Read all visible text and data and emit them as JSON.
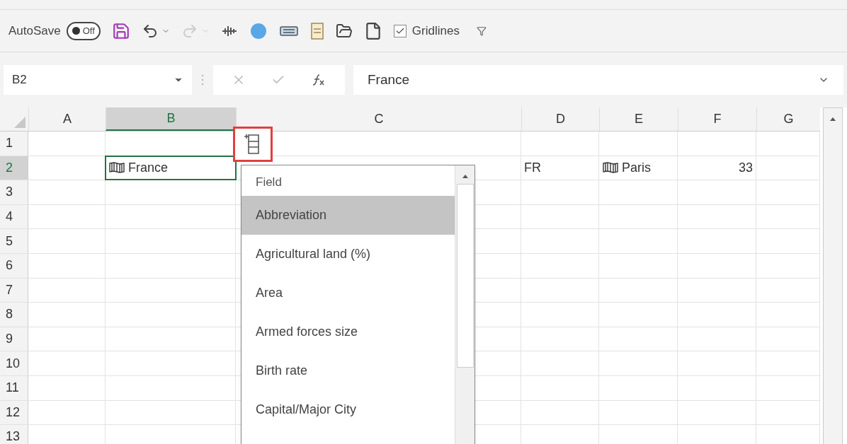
{
  "toolbar": {
    "autosave": {
      "label": "AutoSave",
      "on": false,
      "state_label": "Off"
    },
    "gridlines": {
      "label": "Gridlines",
      "checked": true
    }
  },
  "formula_bar": {
    "name_box": "B2",
    "value": "France"
  },
  "columns": [
    {
      "label": "A",
      "selected": false
    },
    {
      "label": "B",
      "selected": true
    },
    {
      "label": "C",
      "selected": false
    },
    {
      "label": "D",
      "selected": false
    },
    {
      "label": "E",
      "selected": false
    },
    {
      "label": "F",
      "selected": false
    },
    {
      "label": "G",
      "selected": false
    }
  ],
  "rows": [
    {
      "number": "1",
      "selected": false
    },
    {
      "number": "2",
      "selected": true,
      "cells": [
        {},
        {
          "text": "France",
          "kind": "linked",
          "selected": true
        },
        {},
        {
          "text": "FR",
          "kind": "text",
          "selected": false
        },
        {
          "text": "Paris",
          "kind": "linked",
          "selected": false
        },
        {
          "text": "33",
          "kind": "number",
          "selected": false
        },
        {}
      ]
    },
    {
      "number": "3",
      "selected": false
    },
    {
      "number": "4",
      "selected": false
    },
    {
      "number": "5",
      "selected": false
    },
    {
      "number": "6",
      "selected": false
    },
    {
      "number": "7",
      "selected": false
    },
    {
      "number": "8",
      "selected": false
    },
    {
      "number": "9",
      "selected": false
    },
    {
      "number": "10",
      "selected": false
    },
    {
      "number": "11",
      "selected": false
    },
    {
      "number": "12",
      "selected": false
    },
    {
      "number": "13",
      "selected": false
    }
  ],
  "field_menu": {
    "header": "Field",
    "items": [
      {
        "label": "Abbreviation",
        "selected": true
      },
      {
        "label": "Agricultural land (%)",
        "selected": false
      },
      {
        "label": "Area",
        "selected": false
      },
      {
        "label": "Armed forces size",
        "selected": false
      },
      {
        "label": "Birth rate",
        "selected": false
      },
      {
        "label": "Capital/Major City",
        "selected": false
      }
    ]
  }
}
